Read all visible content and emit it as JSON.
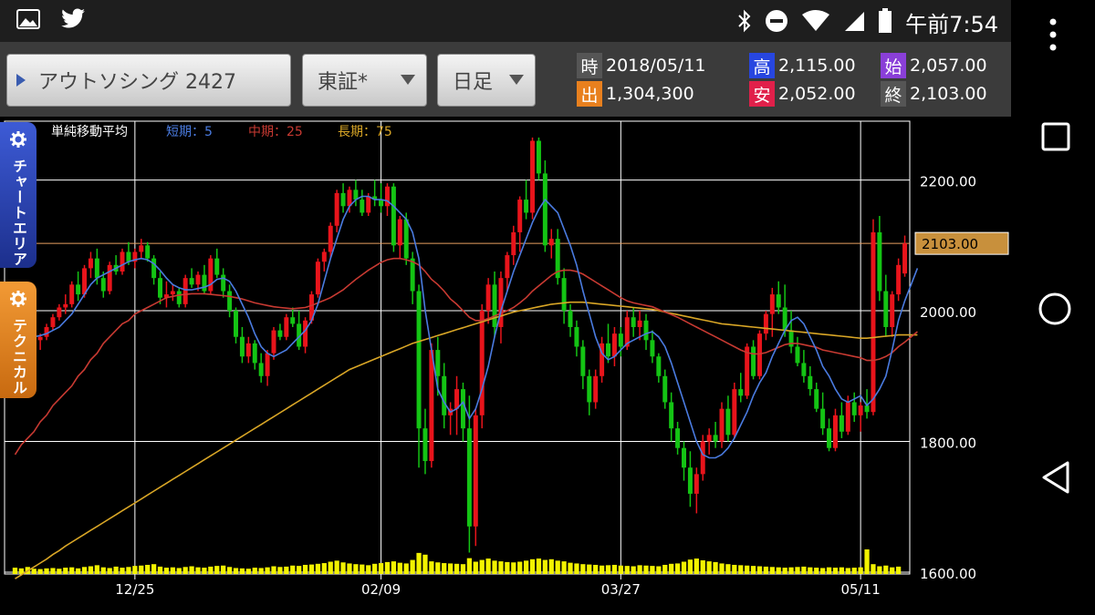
{
  "colors": {
    "status_bg": "#1e1e1e",
    "appbar_bg": "#3b3b3b",
    "up_candle": "#e8141b",
    "down_candle": "#14c414",
    "ma_short": "#4a7be0",
    "ma_mid": "#c83a32",
    "ma_long": "#d9a626",
    "volume": "#f3f300",
    "last_price_line": "#e8a060",
    "tab_chart_area": "#2a46b8",
    "tab_technical": "#e07f18"
  },
  "status_bar": {
    "time": "午前7:54",
    "icons": [
      "gallery-icon",
      "twitter-icon",
      "bluetooth-icon",
      "dnd-icon",
      "wifi-icon",
      "signal-icon",
      "battery-icon"
    ]
  },
  "toolbar": {
    "stock_label": "アウトソシング 2427",
    "market_label": "東証*",
    "period_label": "日足"
  },
  "quote": {
    "date_badge": "時",
    "date": "2018/05/11",
    "high_badge": "高",
    "high": "2,115.00",
    "open_badge": "始",
    "open": "2,057.00",
    "volume_badge": "出",
    "volume": "1,304,300",
    "low_badge": "安",
    "low": "2,052.00",
    "close_badge": "終",
    "close": "2,103.00"
  },
  "side_tabs": {
    "chart_area": "チャートエリア",
    "technical": "テクニカル"
  },
  "chart_data": {
    "type": "candlestick",
    "legend": {
      "title": "単純移動平均",
      "short": "短期：5",
      "mid": "中期：25",
      "long": "長期：75"
    },
    "ylim": [
      1600,
      2290
    ],
    "y_ticks": [
      {
        "value": 2200,
        "label": "2200.00"
      },
      {
        "value": 2000,
        "label": "2000.00"
      },
      {
        "value": 1800,
        "label": "1800.00"
      },
      {
        "value": 1600,
        "label": "1600.00"
      }
    ],
    "last_price": {
      "value": 2103,
      "label": "2103.00"
    },
    "x_ticks": [
      {
        "index": 19,
        "label": "12/25"
      },
      {
        "index": 58,
        "label": "02/09"
      },
      {
        "index": 96,
        "label": "03/27"
      },
      {
        "index": 134,
        "label": "05/11"
      }
    ],
    "ohlc": [
      [
        1930,
        1950,
        1920,
        1945
      ],
      [
        1945,
        1965,
        1935,
        1960
      ],
      [
        1960,
        1975,
        1955,
        1970
      ],
      [
        1970,
        1985,
        1950,
        1955
      ],
      [
        1955,
        1965,
        1940,
        1960
      ],
      [
        1960,
        1980,
        1955,
        1975
      ],
      [
        1975,
        1995,
        1970,
        1990
      ],
      [
        1990,
        2010,
        1985,
        2005
      ],
      [
        2005,
        2025,
        1995,
        2010
      ],
      [
        2010,
        2045,
        2005,
        2040
      ],
      [
        2040,
        2060,
        2015,
        2025
      ],
      [
        2025,
        2070,
        2020,
        2065
      ],
      [
        2065,
        2090,
        2050,
        2080
      ],
      [
        2080,
        2095,
        2040,
        2050
      ],
      [
        2050,
        2060,
        2020,
        2030
      ],
      [
        2030,
        2075,
        2025,
        2070
      ],
      [
        2070,
        2085,
        2055,
        2060
      ],
      [
        2060,
        2095,
        2055,
        2090
      ],
      [
        2090,
        2105,
        2070,
        2075
      ],
      [
        2075,
        2095,
        2065,
        2090
      ],
      [
        2090,
        2110,
        2080,
        2100
      ],
      [
        2100,
        2105,
        2075,
        2080
      ],
      [
        2080,
        2085,
        2040,
        2050
      ],
      [
        2050,
        2060,
        2010,
        2020
      ],
      [
        2020,
        2045,
        2005,
        2025
      ],
      [
        2025,
        2040,
        2015,
        2030
      ],
      [
        2030,
        2035,
        2005,
        2010
      ],
      [
        2010,
        2055,
        2005,
        2050
      ],
      [
        2050,
        2065,
        2035,
        2040
      ],
      [
        2040,
        2060,
        2030,
        2055
      ],
      [
        2055,
        2070,
        2025,
        2030
      ],
      [
        2030,
        2085,
        2025,
        2080
      ],
      [
        2080,
        2095,
        2050,
        2055
      ],
      [
        2055,
        2065,
        2020,
        2030
      ],
      [
        2030,
        2040,
        1990,
        2000
      ],
      [
        2000,
        2005,
        1950,
        1960
      ],
      [
        1960,
        1975,
        1920,
        1930
      ],
      [
        1930,
        1960,
        1920,
        1950
      ],
      [
        1950,
        1955,
        1910,
        1920
      ],
      [
        1920,
        1935,
        1890,
        1900
      ],
      [
        1900,
        1940,
        1885,
        1935
      ],
      [
        1935,
        1975,
        1925,
        1970
      ],
      [
        1970,
        1980,
        1955,
        1960
      ],
      [
        1960,
        1995,
        1955,
        1990
      ],
      [
        1990,
        2005,
        1975,
        1980
      ],
      [
        1980,
        2000,
        1940,
        1945
      ],
      [
        1945,
        1990,
        1935,
        1985
      ],
      [
        1985,
        2030,
        1980,
        2025
      ],
      [
        2025,
        2080,
        2020,
        2075
      ],
      [
        2075,
        2095,
        2060,
        2090
      ],
      [
        2090,
        2135,
        2080,
        2130
      ],
      [
        2130,
        2185,
        2120,
        2180
      ],
      [
        2180,
        2195,
        2150,
        2160
      ],
      [
        2160,
        2190,
        2150,
        2185
      ],
      [
        2185,
        2200,
        2160,
        2170
      ],
      [
        2170,
        2185,
        2145,
        2150
      ],
      [
        2150,
        2180,
        2145,
        2175
      ],
      [
        2175,
        2200,
        2160,
        2170
      ],
      [
        2170,
        2195,
        2150,
        2160
      ],
      [
        2160,
        2195,
        2145,
        2190
      ],
      [
        2190,
        2195,
        2090,
        2100
      ],
      [
        2100,
        2145,
        2080,
        2140
      ],
      [
        2140,
        2150,
        2070,
        2080
      ],
      [
        2080,
        2090,
        2010,
        2030
      ],
      [
        2030,
        2040,
        1760,
        1820
      ],
      [
        1820,
        1850,
        1750,
        1770
      ],
      [
        1770,
        1950,
        1760,
        1940
      ],
      [
        1940,
        1960,
        1870,
        1900
      ],
      [
        1900,
        1920,
        1820,
        1840
      ],
      [
        1840,
        1860,
        1810,
        1850
      ],
      [
        1850,
        1900,
        1810,
        1880
      ],
      [
        1880,
        1890,
        1800,
        1820
      ],
      [
        1820,
        1870,
        1630,
        1670
      ],
      [
        1670,
        1850,
        1640,
        1840
      ],
      [
        1840,
        2010,
        1820,
        2000
      ],
      [
        2000,
        2050,
        1980,
        2040
      ],
      [
        2040,
        2060,
        1960,
        1975
      ],
      [
        1975,
        2060,
        1950,
        2050
      ],
      [
        2050,
        2090,
        2030,
        2085
      ],
      [
        2085,
        2130,
        2070,
        2120
      ],
      [
        2120,
        2175,
        2090,
        2170
      ],
      [
        2170,
        2200,
        2140,
        2150
      ],
      [
        2150,
        2265,
        2140,
        2260
      ],
      [
        2260,
        2265,
        2200,
        2210
      ],
      [
        2210,
        2230,
        2090,
        2100
      ],
      [
        2100,
        2125,
        2080,
        2110
      ],
      [
        2110,
        2125,
        2040,
        2050
      ],
      [
        2050,
        2065,
        1980,
        2000
      ],
      [
        2000,
        2010,
        1960,
        1975
      ],
      [
        1975,
        1985,
        1930,
        1945
      ],
      [
        1945,
        1955,
        1880,
        1900
      ],
      [
        1900,
        1910,
        1840,
        1860
      ],
      [
        1860,
        1910,
        1850,
        1900
      ],
      [
        1900,
        1960,
        1890,
        1950
      ],
      [
        1950,
        1980,
        1920,
        1930
      ],
      [
        1930,
        1975,
        1915,
        1965
      ],
      [
        1965,
        1975,
        1930,
        1945
      ],
      [
        1945,
        2000,
        1940,
        1990
      ],
      [
        1990,
        2005,
        1960,
        1975
      ],
      [
        1975,
        2000,
        1955,
        1985
      ],
      [
        1985,
        1995,
        1940,
        1955
      ],
      [
        1955,
        1970,
        1920,
        1930
      ],
      [
        1930,
        1935,
        1890,
        1900
      ],
      [
        1900,
        1910,
        1850,
        1860
      ],
      [
        1860,
        1875,
        1800,
        1820
      ],
      [
        1820,
        1830,
        1780,
        1790
      ],
      [
        1790,
        1800,
        1740,
        1760
      ],
      [
        1760,
        1785,
        1700,
        1720
      ],
      [
        1720,
        1760,
        1690,
        1750
      ],
      [
        1750,
        1810,
        1740,
        1800
      ],
      [
        1800,
        1820,
        1780,
        1810
      ],
      [
        1810,
        1830,
        1790,
        1800
      ],
      [
        1800,
        1860,
        1790,
        1850
      ],
      [
        1850,
        1870,
        1800,
        1810
      ],
      [
        1810,
        1890,
        1805,
        1880
      ],
      [
        1880,
        1905,
        1860,
        1870
      ],
      [
        1870,
        1950,
        1865,
        1945
      ],
      [
        1945,
        1955,
        1895,
        1900
      ],
      [
        1900,
        1970,
        1895,
        1965
      ],
      [
        1965,
        2000,
        1955,
        1995
      ],
      [
        1995,
        2035,
        1960,
        2025
      ],
      [
        2025,
        2045,
        1995,
        2005
      ],
      [
        2005,
        2040,
        1960,
        1970
      ],
      [
        1970,
        2000,
        1935,
        1945
      ],
      [
        1945,
        1960,
        1915,
        1920
      ],
      [
        1920,
        1940,
        1890,
        1900
      ],
      [
        1900,
        1915,
        1870,
        1880
      ],
      [
        1880,
        1890,
        1845,
        1850
      ],
      [
        1850,
        1875,
        1810,
        1820
      ],
      [
        1820,
        1835,
        1785,
        1790
      ],
      [
        1790,
        1850,
        1785,
        1840
      ],
      [
        1840,
        1860,
        1805,
        1815
      ],
      [
        1815,
        1870,
        1810,
        1860
      ],
      [
        1860,
        1875,
        1830,
        1840
      ],
      [
        1840,
        1860,
        1815,
        1855
      ],
      [
        1855,
        1880,
        1835,
        1845
      ],
      [
        1845,
        2140,
        1840,
        2120
      ],
      [
        2120,
        2145,
        2015,
        2030
      ],
      [
        2030,
        2055,
        1960,
        1975
      ],
      [
        1975,
        2030,
        1960,
        2025
      ],
      [
        2025,
        2080,
        2015,
        2070
      ],
      [
        2057,
        2115,
        2052,
        2103
      ]
    ],
    "ma_short": [
      1970,
      1955,
      1958,
      1960,
      1962,
      1965,
      1970,
      1975,
      1985,
      1995,
      2010,
      2025,
      2040,
      2050,
      2055,
      2060,
      2065,
      2070,
      2075,
      2078,
      2080,
      2078,
      2072,
      2062,
      2050,
      2040,
      2035,
      2032,
      2032,
      2034,
      2036,
      2040,
      2048,
      2050,
      2045,
      2030,
      2010,
      1990,
      1965,
      1945,
      1935,
      1930,
      1935,
      1940,
      1950,
      1960,
      1970,
      1985,
      2010,
      2045,
      2080,
      2110,
      2140,
      2160,
      2170,
      2175,
      2175,
      2170,
      2170,
      2168,
      2160,
      2150,
      2140,
      2120,
      2080,
      2000,
      1940,
      1880,
      1860,
      1845,
      1850,
      1860,
      1835,
      1850,
      1880,
      1915,
      1960,
      2000,
      2030,
      2060,
      2085,
      2110,
      2135,
      2155,
      2170,
      2160,
      2150,
      2125,
      2100,
      2070,
      2030,
      1995,
      1960,
      1935,
      1925,
      1930,
      1940,
      1950,
      1955,
      1960,
      1965,
      1968,
      1960,
      1945,
      1920,
      1890,
      1860,
      1830,
      1800,
      1780,
      1775,
      1775,
      1780,
      1790,
      1805,
      1825,
      1845,
      1870,
      1890,
      1905,
      1930,
      1950,
      1970,
      1985,
      1990,
      1980,
      1960,
      1940,
      1915,
      1900,
      1880,
      1865,
      1860,
      1865,
      1870,
      1855,
      1865,
      1880,
      1900,
      1940,
      1985,
      2015,
      2040,
      2065
    ],
    "ma_mid": [
      1780,
      1795,
      1805,
      1815,
      1830,
      1840,
      1855,
      1865,
      1875,
      1885,
      1900,
      1910,
      1925,
      1935,
      1950,
      1960,
      1970,
      1980,
      1985,
      1995,
      2000,
      2005,
      2010,
      2015,
      2020,
      2022,
      2024,
      2025,
      2026,
      2026,
      2026,
      2025,
      2024,
      2023,
      2022,
      2020,
      2018,
      2015,
      2012,
      2010,
      2008,
      2006,
      2005,
      2004,
      2003,
      2004,
      2005,
      2008,
      2012,
      2016,
      2020,
      2026,
      2032,
      2040,
      2048,
      2055,
      2062,
      2068,
      2074,
      2078,
      2080,
      2080,
      2078,
      2075,
      2070,
      2060,
      2048,
      2040,
      2030,
      2018,
      2010,
      2000,
      1990,
      1985,
      1985,
      1988,
      1992,
      1996,
      2000,
      2005,
      2012,
      2020,
      2030,
      2038,
      2046,
      2054,
      2060,
      2062,
      2062,
      2060,
      2056,
      2050,
      2044,
      2038,
      2032,
      2026,
      2020,
      2015,
      2012,
      2010,
      2008,
      2006,
      2002,
      1998,
      1994,
      1990,
      1985,
      1980,
      1975,
      1970,
      1965,
      1960,
      1955,
      1950,
      1945,
      1940,
      1936,
      1934,
      1934,
      1936,
      1940,
      1944,
      1948,
      1950,
      1950,
      1948,
      1946,
      1944,
      1940,
      1938,
      1936,
      1934,
      1932,
      1930,
      1928,
      1924,
      1924,
      1926,
      1930,
      1936,
      1945,
      1952,
      1960,
      1968
    ],
    "ma_long": [
      1590,
      1596,
      1602,
      1608,
      1614,
      1620,
      1627,
      1633,
      1640,
      1646,
      1652,
      1658,
      1664,
      1670,
      1676,
      1682,
      1688,
      1694,
      1700,
      1706,
      1712,
      1718,
      1724,
      1730,
      1736,
      1742,
      1748,
      1754,
      1760,
      1766,
      1772,
      1778,
      1784,
      1790,
      1796,
      1802,
      1808,
      1814,
      1820,
      1826,
      1832,
      1838,
      1844,
      1850,
      1856,
      1862,
      1868,
      1874,
      1880,
      1886,
      1892,
      1898,
      1904,
      1910,
      1914,
      1918,
      1922,
      1926,
      1930,
      1934,
      1938,
      1942,
      1946,
      1950,
      1953,
      1956,
      1959,
      1962,
      1965,
      1968,
      1971,
      1974,
      1977,
      1980,
      1983,
      1986,
      1989,
      1992,
      1995,
      1998,
      2000,
      2002,
      2004,
      2006,
      2008,
      2010,
      2011,
      2012,
      2013,
      2013,
      2013,
      2012,
      2011,
      2010,
      2009,
      2008,
      2007,
      2006,
      2005,
      2004,
      2003,
      2002,
      2000,
      1998,
      1996,
      1994,
      1992,
      1990,
      1988,
      1986,
      1984,
      1982,
      1980,
      1979,
      1978,
      1977,
      1976,
      1975,
      1974,
      1973,
      1972,
      1971,
      1970,
      1969,
      1968,
      1967,
      1966,
      1965,
      1964,
      1963,
      1962,
      1961,
      1960,
      1959,
      1958,
      1958,
      1959,
      1960,
      1961,
      1962,
      1963,
      1963,
      1963,
      1963
    ],
    "volume": [
      18,
      16,
      20,
      15,
      14,
      16,
      17,
      15,
      18,
      19,
      16,
      20,
      22,
      25,
      19,
      17,
      21,
      18,
      20,
      23,
      24,
      26,
      28,
      21,
      18,
      19,
      17,
      20,
      22,
      19,
      18,
      21,
      23,
      24,
      20,
      17,
      16,
      15,
      18,
      17,
      19,
      22,
      20,
      21,
      24,
      23,
      26,
      27,
      29,
      31,
      35,
      38,
      33,
      30,
      28,
      27,
      25,
      29,
      31,
      34,
      36,
      32,
      30,
      40,
      60,
      55,
      36,
      33,
      31,
      30,
      29,
      28,
      45,
      35,
      40,
      44,
      38,
      36,
      34,
      33,
      35,
      38,
      42,
      44,
      40,
      42,
      38,
      36,
      32,
      30,
      28,
      27,
      26,
      24,
      25,
      26,
      24,
      23,
      22,
      25,
      24,
      23,
      22,
      26,
      29,
      30,
      35,
      41,
      44,
      39,
      36,
      34,
      30,
      28,
      26,
      25,
      24,
      23,
      22,
      21,
      20,
      19,
      18,
      19,
      20,
      21,
      19,
      18,
      17,
      19,
      18,
      19,
      17,
      18,
      19,
      70,
      28,
      22,
      24,
      19,
      21
    ]
  }
}
